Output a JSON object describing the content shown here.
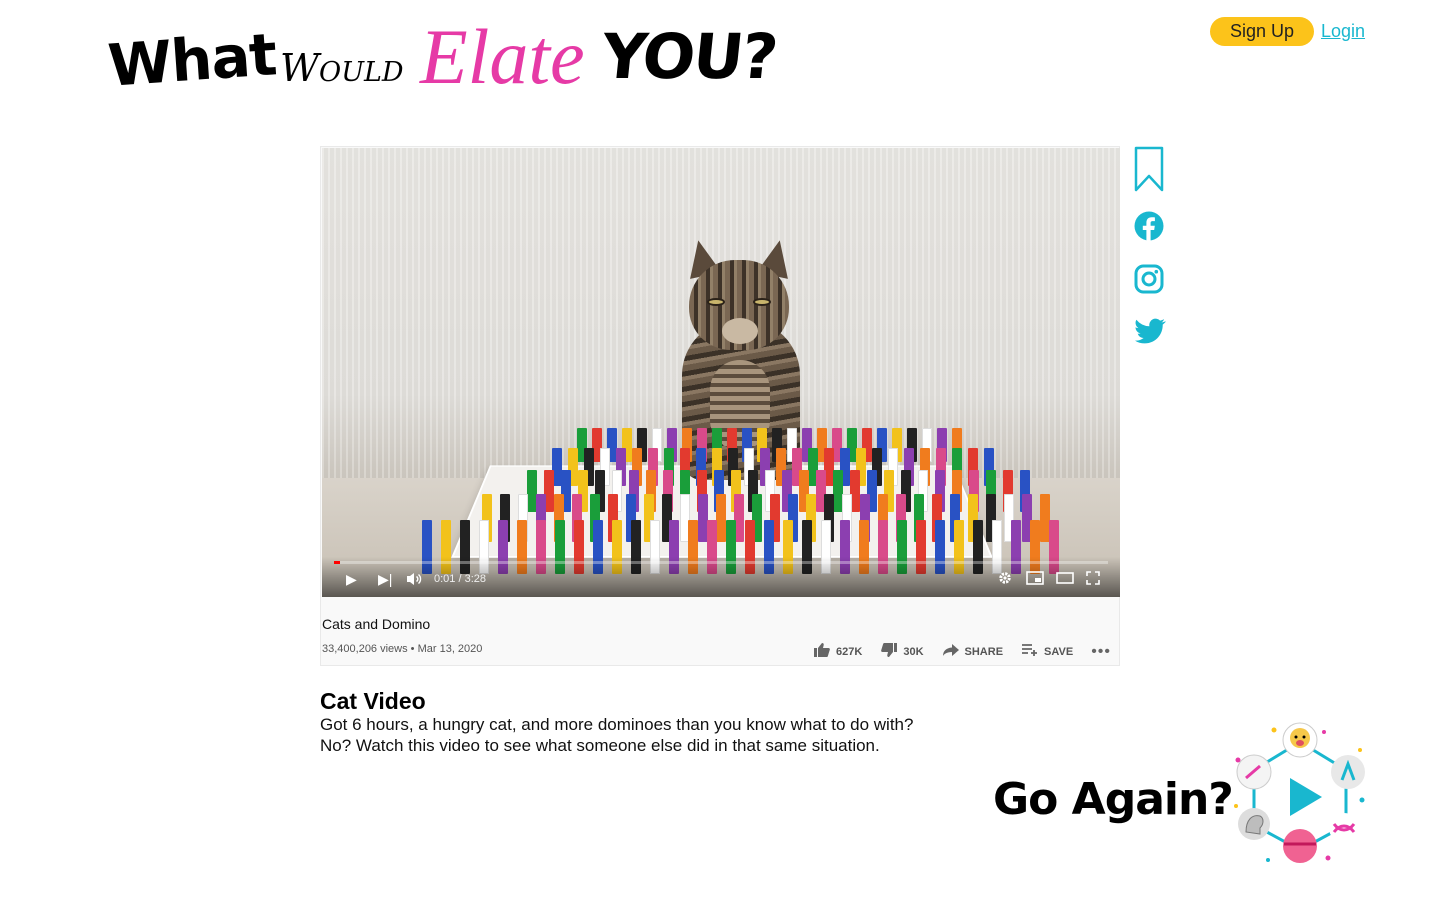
{
  "logo": {
    "word1": "What",
    "word2": "Would",
    "word3": "Elate",
    "word4": "YOU?"
  },
  "auth": {
    "signup_label": "Sign Up",
    "login_label": "Login"
  },
  "video": {
    "time": "0:01 / 3:28",
    "progress": 0.005,
    "title": "Cats and Domino",
    "meta": "33,400,206 views • Mar 13, 2020",
    "actions": {
      "like": "627K",
      "dislike": "30K",
      "share": "SHARE",
      "save": "SAVE"
    }
  },
  "social": {
    "icons": [
      "bookmark-icon",
      "facebook-icon",
      "instagram-icon",
      "twitter-icon"
    ],
    "accent": "#19b7cf"
  },
  "description": {
    "title": "Cat Video",
    "text": "Got 6 hours, a hungry cat, and more dominoes than you know what to do with? No? Watch this video to see what someone else did in that same situation."
  },
  "go_again": {
    "label": "Go Again?"
  },
  "colors": {
    "brand_pink": "#e63aa6",
    "signup_yellow": "#fcc31a",
    "link_teal": "#19b7cf"
  }
}
